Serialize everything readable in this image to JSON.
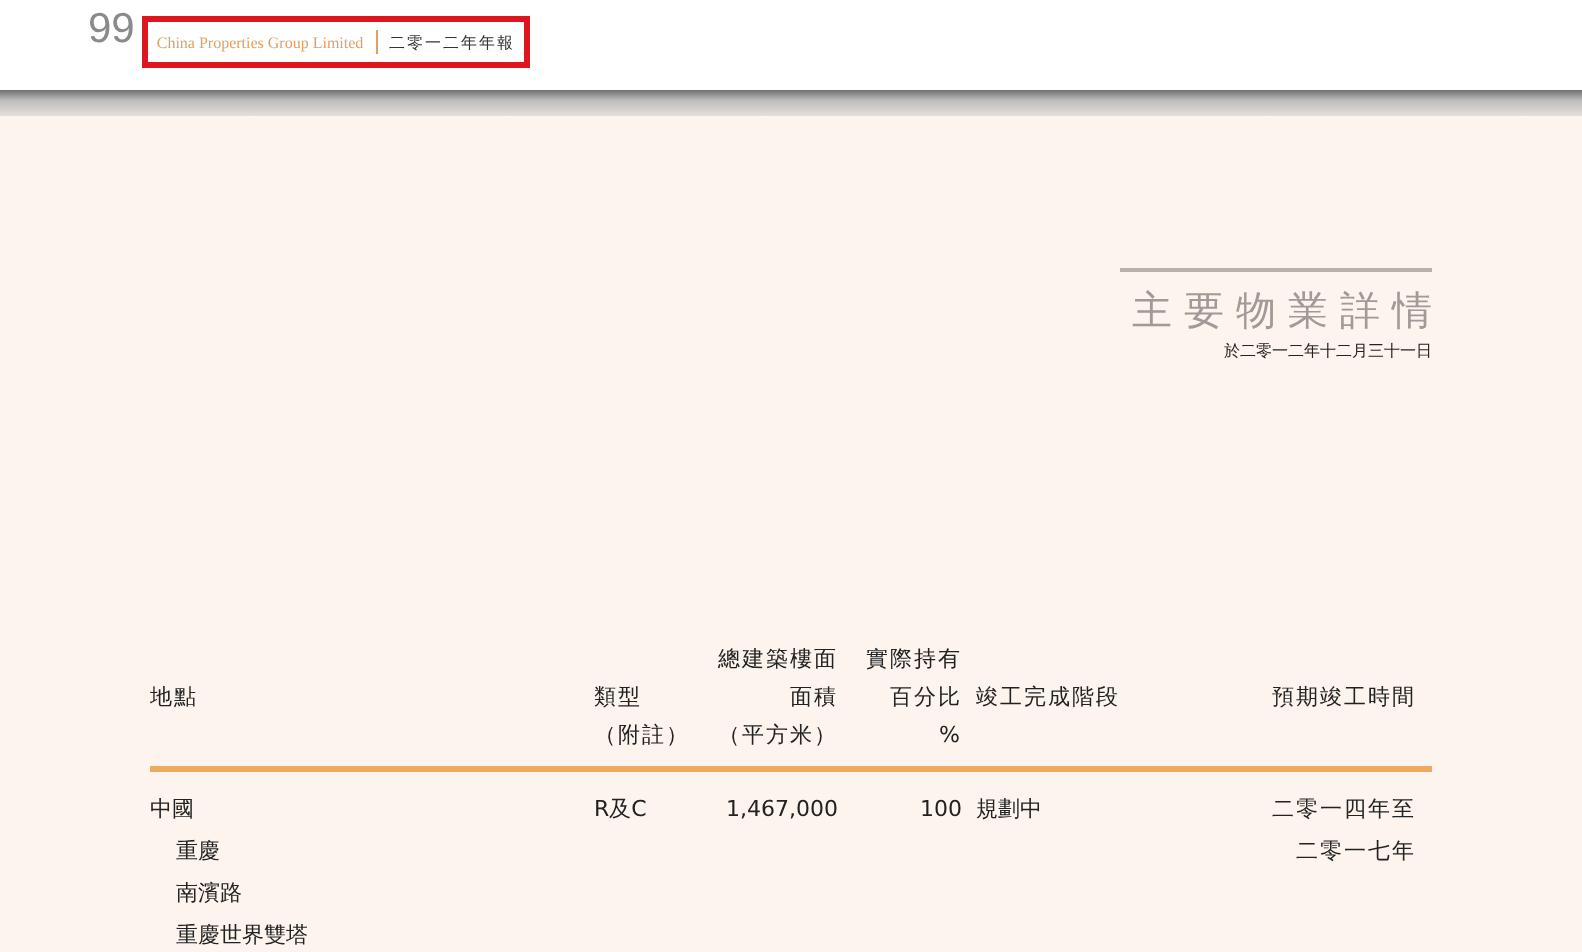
{
  "header": {
    "page_number": "99",
    "company": "China Properties Group Limited",
    "report": "二零一二年年報"
  },
  "section": {
    "title": "主要物業詳情",
    "date": "於二零一二年十二月三十一日"
  },
  "table": {
    "columns": [
      {
        "heading": "地點"
      },
      {
        "heading": "類型",
        "note": "（附註）"
      },
      {
        "top": "總建築樓面",
        "heading": "面積",
        "note": "（平方米）"
      },
      {
        "top": "實際持有",
        "heading": "百分比",
        "note": "%"
      },
      {
        "heading": "竣工完成階段"
      },
      {
        "heading": "預期竣工時間"
      }
    ],
    "rows": [
      {
        "location": "中國",
        "children": [
          {
            "location": "重慶"
          },
          {
            "location": "南濱路"
          },
          {
            "location": "重慶世界雙塔"
          }
        ],
        "type": "R及C",
        "area": "1,467,000",
        "percent": "100",
        "stage": "規劃中",
        "completion": "二零一四年至二零一七年"
      }
    ]
  }
}
